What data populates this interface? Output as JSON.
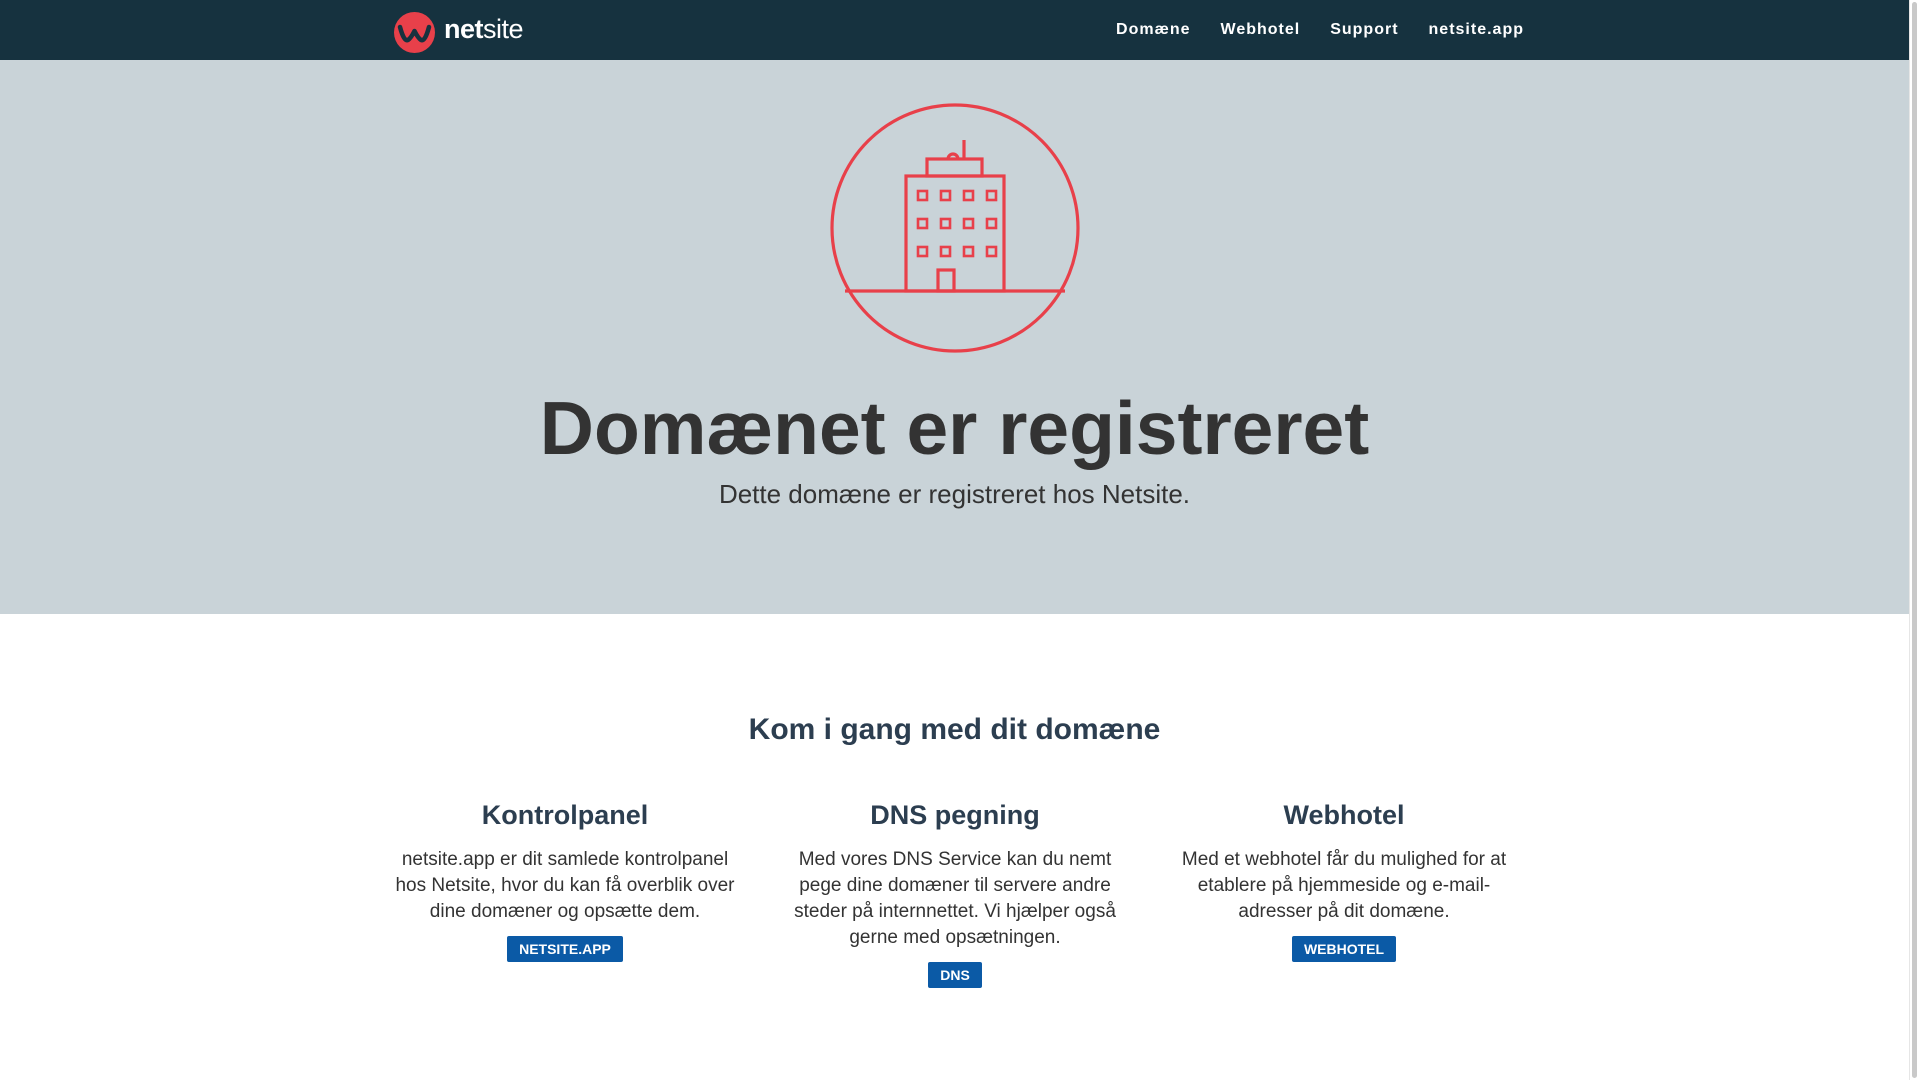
{
  "navbar": {
    "logo_bold": "net",
    "logo_light": "site",
    "links": [
      "Domæne",
      "Webhotel",
      "Support",
      "netsite.app"
    ]
  },
  "hero": {
    "icon": "office-building-icon",
    "title": "Domænet er registreret",
    "subtitle": "Dette domæne er registreret hos Netsite."
  },
  "section": {
    "title": "Kom i gang med dit domæne",
    "columns": [
      {
        "title": "Kontrolpanel",
        "text": "netsite.app er dit samlede kontrolpanel hos Netsite, hvor du kan få overblik over dine domæner og opsætte dem.",
        "button": "NETSITE.APP"
      },
      {
        "title": "DNS pegning",
        "text": "Med vores DNS Service kan du nemt pege dine domæner til servere andre steder på internnettet. Vi hjælper også gerne med opsætningen.",
        "button": "DNS"
      },
      {
        "title": "Webhotel",
        "text": "Med et webhotel får du mulighed for at etablere på hjemmeside og e-mail-adresser på dit domæne.",
        "button": "WEBHOTEL"
      }
    ]
  },
  "colors": {
    "navbar": "#16323f",
    "hero_bg": "#c9d3d8",
    "accent_red": "#e8404a",
    "button_blue": "#0b5aa6",
    "heading": "#2c3e50"
  }
}
